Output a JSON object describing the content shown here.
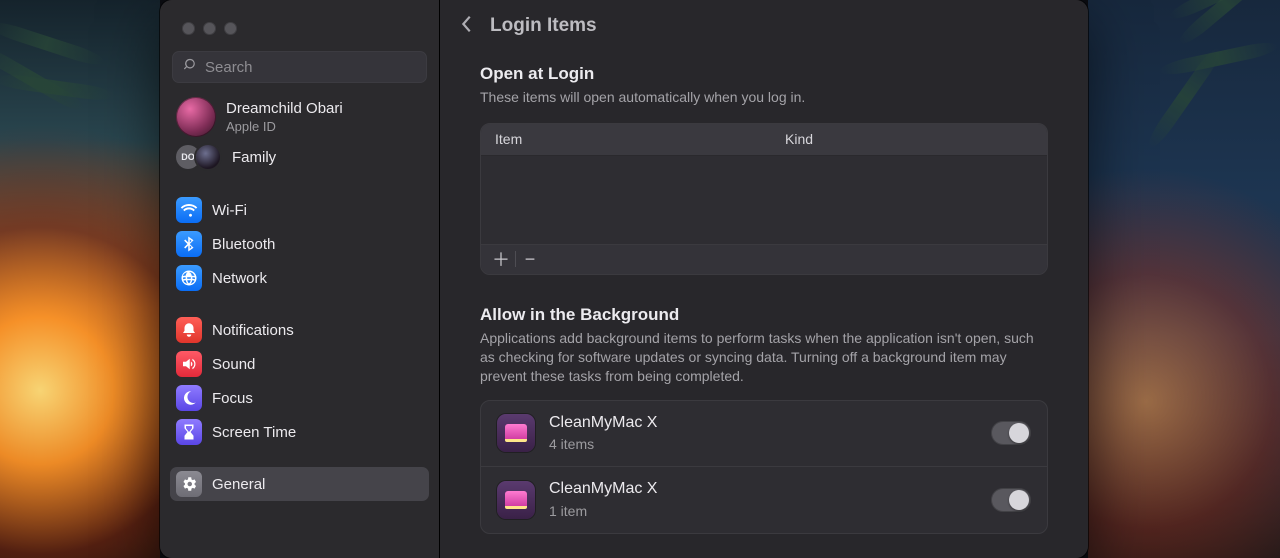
{
  "page_title": "Login Items",
  "search_placeholder": "Search",
  "account": {
    "name": "Dreamchild Obari",
    "sub": "Apple ID"
  },
  "family_label": "Family",
  "family_initials": "DO",
  "sidebar": [
    {
      "key": "wifi",
      "label": "Wi-Fi",
      "icon": "wifi"
    },
    {
      "key": "bluetooth",
      "label": "Bluetooth",
      "icon": "bluetooth"
    },
    {
      "key": "network",
      "label": "Network",
      "icon": "network"
    },
    {
      "key": "notifications",
      "label": "Notifications",
      "icon": "notifications"
    },
    {
      "key": "sound",
      "label": "Sound",
      "icon": "sound"
    },
    {
      "key": "focus",
      "label": "Focus",
      "icon": "focus"
    },
    {
      "key": "screentime",
      "label": "Screen Time",
      "icon": "screentime"
    },
    {
      "key": "general",
      "label": "General",
      "icon": "general",
      "active": true
    }
  ],
  "open_at_login": {
    "title": "Open at Login",
    "desc": "These items will open automatically when you log in.",
    "col_item": "Item",
    "col_kind": "Kind"
  },
  "background": {
    "title": "Allow in the Background",
    "desc": "Applications add background items to perform tasks when the application isn't open, such as checking for software updates or syncing data. Turning off a background item may prevent these tasks from being completed.",
    "rows": [
      {
        "name": "CleanMyMac X",
        "sub": "4 items"
      },
      {
        "name": "CleanMyMac X",
        "sub": "1 item"
      }
    ]
  }
}
